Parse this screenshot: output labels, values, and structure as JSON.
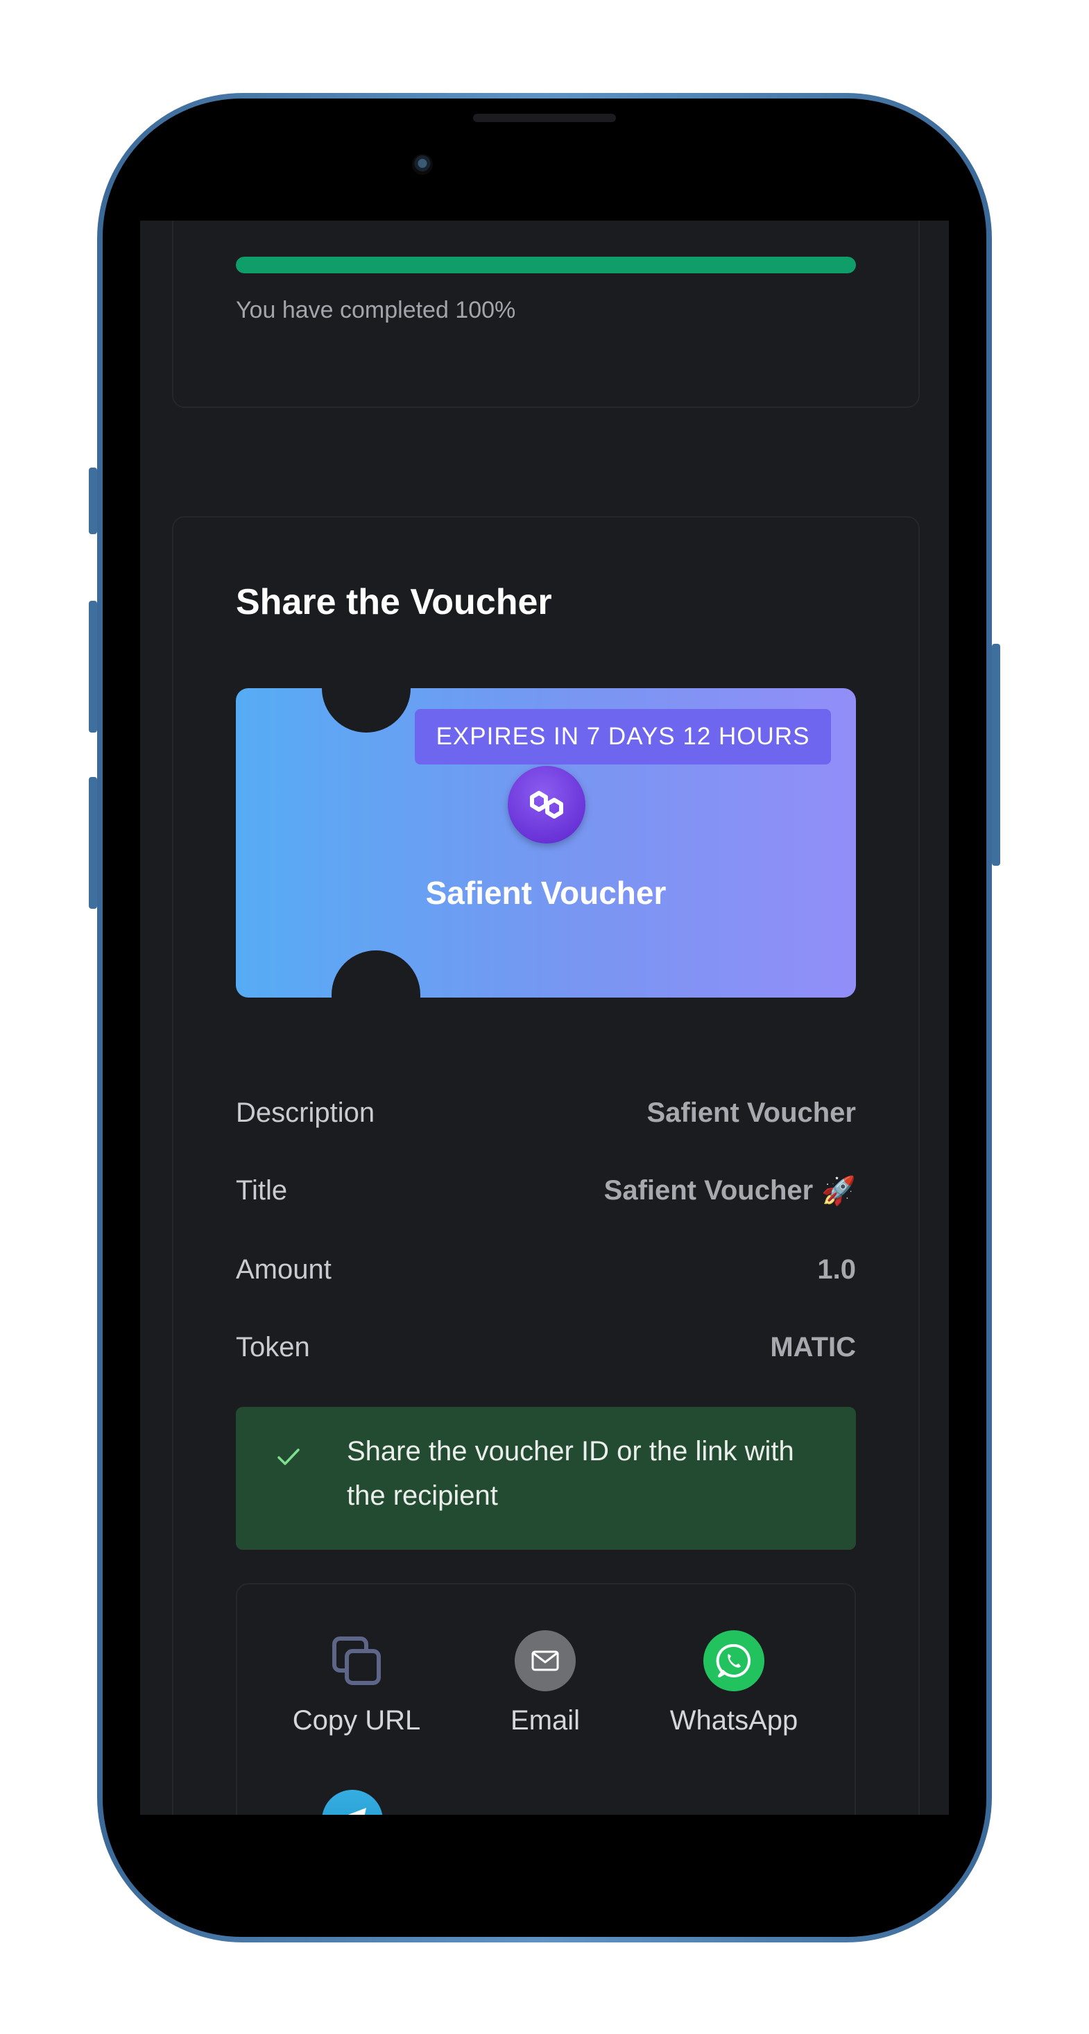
{
  "progress": {
    "percent": 100,
    "text": "You have completed 100%"
  },
  "share": {
    "title": "Share the Voucher",
    "voucher": {
      "expires_badge": "EXPIRES IN 7 DAYS 12 HOURS",
      "name": "Safient Voucher",
      "logo_icon": "polygon-logo-icon"
    },
    "details": [
      {
        "label": "Description",
        "value": "Safient Voucher"
      },
      {
        "label": "Title",
        "value": "Safient Voucher",
        "emoji": "🚀"
      },
      {
        "label": "Amount",
        "value": "1.0"
      },
      {
        "label": "Token",
        "value": "MATIC"
      }
    ],
    "alert": {
      "icon": "check-icon",
      "text": "Share the voucher ID or the link with the recipient"
    },
    "buttons": [
      {
        "label": "Copy URL",
        "icon": "copy-icon"
      },
      {
        "label": "Email",
        "icon": "email-icon"
      },
      {
        "label": "WhatsApp",
        "icon": "whatsapp-icon"
      },
      {
        "label": "",
        "icon": "telegram-icon"
      }
    ]
  },
  "colors": {
    "screen_bg": "#1b1c20",
    "progress": "#0f9e6a",
    "alert_bg": "#234b31",
    "voucher_gradient_start": "#56acf4",
    "voucher_gradient_end": "#928ef8",
    "frame": "#4a7cae"
  }
}
